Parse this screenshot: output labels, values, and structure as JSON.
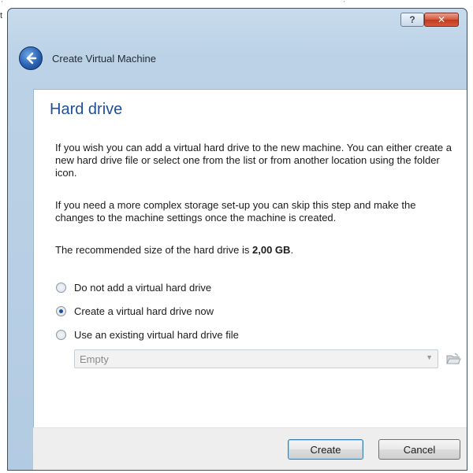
{
  "background": {
    "sliver_text": "t"
  },
  "window": {
    "help_button_label": "?",
    "close_button_label": "✕"
  },
  "header": {
    "title": "Create Virtual Machine",
    "back_icon": "back-arrow-icon"
  },
  "page": {
    "title": "Hard drive",
    "paragraph1": "If you wish you can add a virtual hard drive to the new machine. You can either create a new hard drive file or select one from the list or from another location using the folder icon.",
    "paragraph2": "If you need a more complex storage set-up you can skip this step and make the changes to the machine settings once the machine is created.",
    "recommended_prefix": "The recommended size of the hard drive is ",
    "recommended_size": "2,00 GB",
    "recommended_suffix": "."
  },
  "options": [
    {
      "label": "Do not add a virtual hard drive",
      "checked": false
    },
    {
      "label": "Create a virtual hard drive now",
      "checked": true
    },
    {
      "label": "Use an existing virtual hard drive file",
      "checked": false
    }
  ],
  "disk_selector": {
    "value": "Empty",
    "enabled": false,
    "folder_icon": "folder-icon"
  },
  "buttons": {
    "create": "Create",
    "cancel": "Cancel"
  },
  "colors": {
    "title_blue": "#1e4f9c",
    "close_red": "#c2391d"
  }
}
